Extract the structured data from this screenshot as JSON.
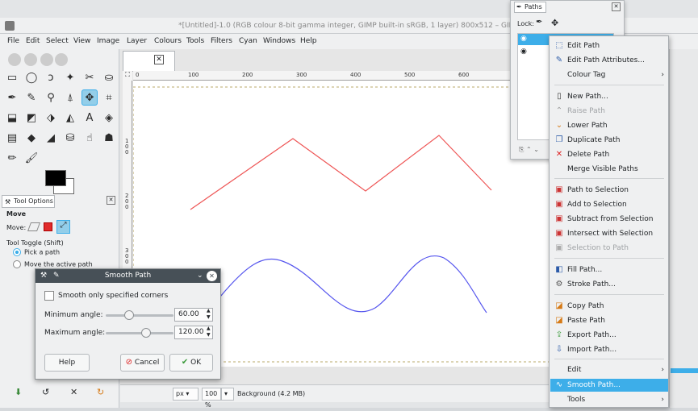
{
  "window": {
    "title": "*[Untitled]-1.0 (RGB colour 8-bit gamma integer, GIMP built-in sRGB, 1 layer) 800x512 – GIMP"
  },
  "menubar": [
    "File",
    "Edit",
    "Select",
    "View",
    "Image",
    "Layer",
    "Colours",
    "Tools",
    "Filters",
    "Cyan",
    "Windows",
    "Help"
  ],
  "tool_options": {
    "tab_label": "Tool Options",
    "tool_name": "Move",
    "move_label": "Move:",
    "toggle_label": "Tool Toggle (Shift)",
    "radio_1": "Pick a path",
    "radio_2": "Move the active path"
  },
  "ruler": {
    "h_ticks": [
      "0",
      "100",
      "200",
      "300",
      "400",
      "500",
      "600"
    ],
    "v_ticks": [
      "1\n0\n0",
      "2\n0\n0",
      "3\n0\n0"
    ]
  },
  "statusbar": {
    "unit": "px",
    "zoom": "100 %",
    "layer_info": "Background (4.2 MB)"
  },
  "smooth_dialog": {
    "title": "Smooth Path",
    "checkbox_label": "Smooth only specified corners",
    "min_label": "Minimum angle:",
    "min_value": "60.00",
    "max_label": "Maximum angle:",
    "max_value": "120.00",
    "help": "Help",
    "cancel": "Cancel",
    "ok": "OK"
  },
  "paths_dock": {
    "title": "Paths",
    "lock_label": "Lock:"
  },
  "context_menu": {
    "items": [
      {
        "label": "Edit Path",
        "icon": "edit-path-icon",
        "glyph": "⬚"
      },
      {
        "label": "Edit Path Attributes...",
        "icon": "pencil-icon",
        "glyph": "✎"
      },
      {
        "label": "Colour Tag",
        "icon": "",
        "glyph": ""
      },
      {
        "label": "New Path...",
        "icon": "new-path-icon",
        "glyph": "▯"
      },
      {
        "label": "Raise Path",
        "icon": "raise-icon",
        "glyph": "⌃"
      },
      {
        "label": "Lower Path",
        "icon": "lower-icon",
        "glyph": "⌄"
      },
      {
        "label": "Duplicate Path",
        "icon": "duplicate-icon",
        "glyph": "❐"
      },
      {
        "label": "Delete Path",
        "icon": "delete-icon",
        "glyph": "✕"
      },
      {
        "label": "Merge Visible Paths",
        "icon": "",
        "glyph": ""
      },
      {
        "label": "Path to Selection",
        "icon": "path-to-selection-icon",
        "glyph": "▣"
      },
      {
        "label": "Add to Selection",
        "icon": "add-selection-icon",
        "glyph": "▣"
      },
      {
        "label": "Subtract from Selection",
        "icon": "subtract-selection-icon",
        "glyph": "▣"
      },
      {
        "label": "Intersect with Selection",
        "icon": "intersect-selection-icon",
        "glyph": "▣"
      },
      {
        "label": "Selection to Path",
        "icon": "selection-to-path-icon",
        "glyph": "▣"
      },
      {
        "label": "Fill Path...",
        "icon": "fill-icon",
        "glyph": "◧"
      },
      {
        "label": "Stroke Path...",
        "icon": "stroke-icon",
        "glyph": "⚙"
      },
      {
        "label": "Copy Path",
        "icon": "copy-icon",
        "glyph": "◪"
      },
      {
        "label": "Paste Path",
        "icon": "paste-icon",
        "glyph": "◪"
      },
      {
        "label": "Export Path...",
        "icon": "export-icon",
        "glyph": "⇪"
      },
      {
        "label": "Import Path...",
        "icon": "import-icon",
        "glyph": "⇩"
      },
      {
        "label": "Edit",
        "icon": "",
        "glyph": ""
      },
      {
        "label": "Smooth Path...",
        "icon": "smooth-path-icon",
        "glyph": "∿"
      },
      {
        "label": "Tools",
        "icon": "",
        "glyph": ""
      }
    ]
  },
  "colors": {
    "red_path": "#ee5555",
    "blue_path": "#5555ee",
    "accent": "#3daee9"
  }
}
